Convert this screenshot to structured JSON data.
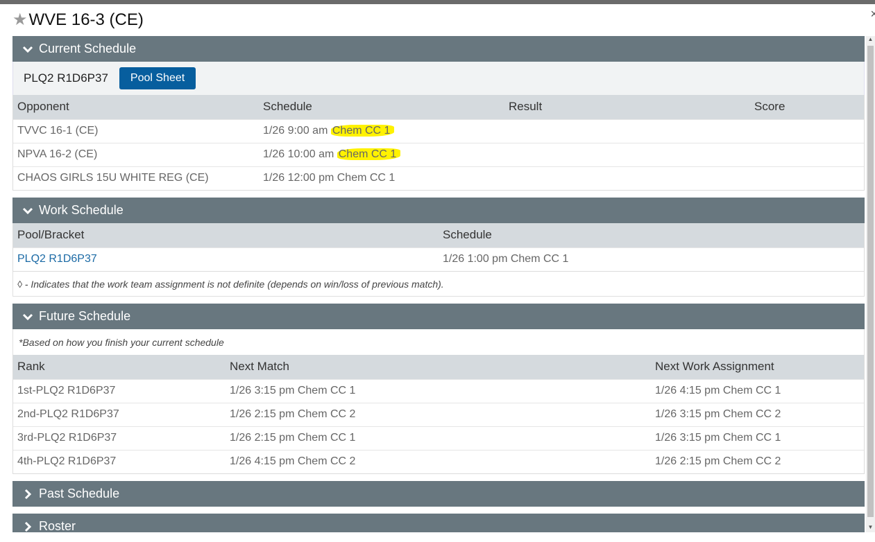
{
  "window": {
    "title": "WVE 16-3 (CE)",
    "close_glyph": "×"
  },
  "current_schedule": {
    "header": "Current Schedule",
    "pool_name": "PLQ2 R1D6P37",
    "pool_sheet_button": "Pool Sheet",
    "columns": [
      "Opponent",
      "Schedule",
      "Result",
      "Score"
    ],
    "rows": [
      {
        "opponent": "TVVC 16-1 (CE)",
        "time": "1/26 9:00 am",
        "court": "Chem CC 1",
        "highlighted": true
      },
      {
        "opponent": "NPVA 16-2 (CE)",
        "time": "1/26 10:00 am",
        "court": "Chem CC 1",
        "highlighted": true
      },
      {
        "opponent": "CHAOS GIRLS 15U WHITE REG (CE)",
        "time": "1/26 12:00 pm",
        "court": "Chem CC 1",
        "highlighted": false
      }
    ]
  },
  "work_schedule": {
    "header": "Work Schedule",
    "columns": [
      "Pool/Bracket",
      "Schedule"
    ],
    "rows": [
      {
        "pool": "PLQ2 R1D6P37",
        "schedule": "1/26 1:00 pm Chem CC 1"
      }
    ],
    "note": "◊ - Indicates that the work team assignment is not definite (depends on win/loss of previous match)."
  },
  "future_schedule": {
    "header": "Future Schedule",
    "note": "*Based on how you finish your current schedule",
    "columns": [
      "Rank",
      "Next Match",
      "Next Work Assignment"
    ],
    "rows": [
      {
        "rank": "1st-PLQ2 R1D6P37",
        "next_match": "1/26 3:15 pm Chem CC 1",
        "next_work": "1/26 4:15 pm Chem CC 1"
      },
      {
        "rank": "2nd-PLQ2 R1D6P37",
        "next_match": "1/26 2:15 pm Chem CC 2",
        "next_work": "1/26 3:15 pm Chem CC 2"
      },
      {
        "rank": "3rd-PLQ2 R1D6P37",
        "next_match": "1/26 2:15 pm Chem CC 1",
        "next_work": "1/26 3:15 pm Chem CC 1"
      },
      {
        "rank": "4th-PLQ2 R1D6P37",
        "next_match": "1/26 4:15 pm Chem CC 2",
        "next_work": "1/26 2:15 pm Chem CC 2"
      }
    ]
  },
  "past_schedule": {
    "header": "Past Schedule"
  },
  "roster": {
    "header": "Roster"
  },
  "colors": {
    "section_header": "#68777f",
    "button": "#075e9e",
    "highlight": "#fff200",
    "link": "#1b6aa5"
  }
}
